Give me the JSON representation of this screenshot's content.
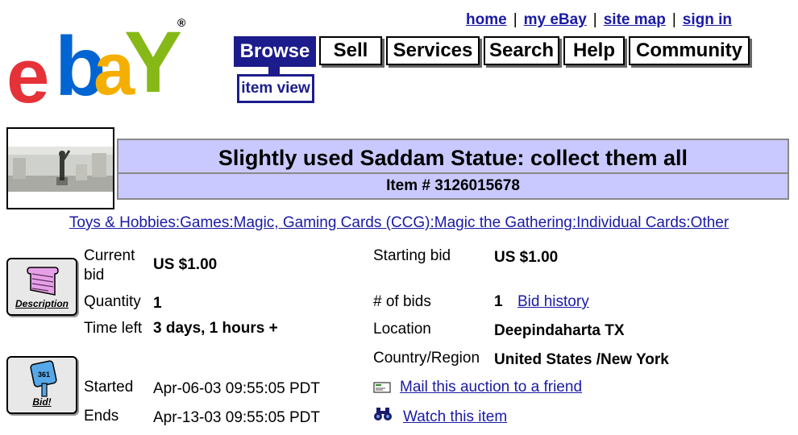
{
  "logo": {
    "letters": [
      "e",
      "b",
      "a",
      "Y"
    ],
    "registered": "®",
    "colors": [
      "#e53238",
      "#0064d2",
      "#f5af02",
      "#86b817"
    ]
  },
  "toplinks": [
    {
      "label": "home"
    },
    {
      "label": "my eBay"
    },
    {
      "label": "site map"
    },
    {
      "label": "sign in"
    }
  ],
  "tabs": [
    {
      "label": "Browse",
      "active": true
    },
    {
      "label": "Sell"
    },
    {
      "label": "Services"
    },
    {
      "label": "Search"
    },
    {
      "label": "Help"
    },
    {
      "label": "Community"
    }
  ],
  "subtab": "item view",
  "item": {
    "title": "Slightly used Saddam Statue: collect them all",
    "item_number": "Item # 3126015678"
  },
  "category": "Toys & Hobbies:Games:Magic, Gaming Cards (CCG):Magic the Gathering:Individual Cards:Other",
  "details": {
    "current_bid_label": "Current bid",
    "current_bid": "US $1.00",
    "quantity_label": "Quantity",
    "quantity": "1",
    "time_left_label": "Time left",
    "time_left": "3 days, 1 hours +",
    "started_label": "Started",
    "started": "Apr-06-03 09:55:05 PDT",
    "ends_label": "Ends",
    "ends": "Apr-13-03 09:55:05 PDT",
    "starting_bid_label": "Starting bid",
    "starting_bid": "US $1.00",
    "num_bids_label": "# of bids",
    "num_bids": "1",
    "bid_history": "Bid history",
    "location_label": "Location",
    "location": "Deepindaharta TX",
    "country_label": "Country/Region",
    "country": "United States /New York",
    "mail_link": "Mail this auction to a friend",
    "watch_link": "Watch this item"
  },
  "icons": {
    "description_caption": "Description",
    "bid_caption": "Bid!",
    "bid_paddle_text": "361"
  }
}
